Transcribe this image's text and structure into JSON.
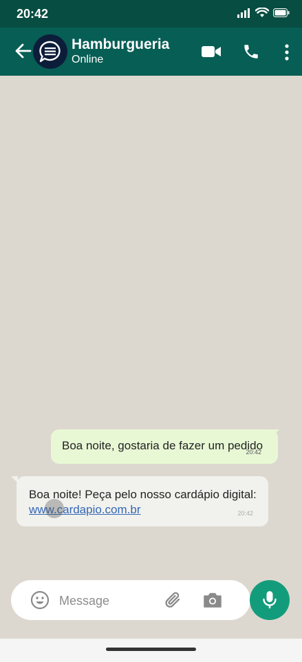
{
  "status_bar": {
    "time": "20:42",
    "icons": [
      "signal-icon",
      "wifi-icon",
      "battery-icon"
    ]
  },
  "header": {
    "back_icon": "arrow-left-icon",
    "avatar_icon": "chat-bubble-icon",
    "name": "Hamburgueria",
    "status": "Online",
    "actions": [
      "video-call-icon",
      "phone-icon",
      "more-vert-icon"
    ]
  },
  "messages": [
    {
      "direction": "outgoing",
      "text": "Boa noite, gostaria de fazer um pedido",
      "time": "20:42"
    },
    {
      "direction": "incoming",
      "text": "Boa noite! Peça pelo nosso cardápio digital:",
      "link": "www.cardapio.com.br",
      "time": "20:42"
    }
  ],
  "composer": {
    "placeholder": "Message",
    "icons": [
      "emoji-icon",
      "paperclip-icon",
      "camera-icon",
      "mic-icon"
    ]
  },
  "colors": {
    "header": "#075e54",
    "status_bar": "#074d41",
    "chat_bg": "#ddd8cf",
    "outgoing_bubble": "#e8f8d5",
    "incoming_bubble": "#f1f1ee",
    "link": "#3467b4",
    "mic_button": "#139c7b"
  }
}
